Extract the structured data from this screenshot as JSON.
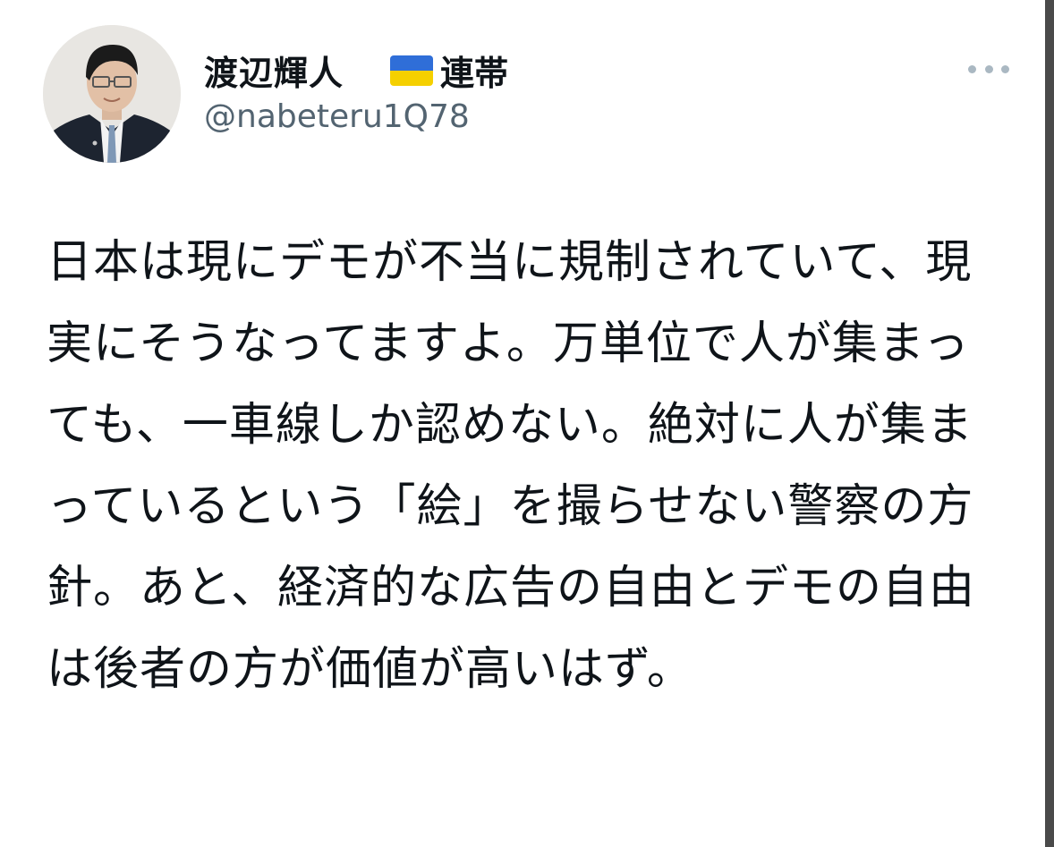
{
  "tweet": {
    "display_name": "渡辺輝人",
    "flag_icon": "ukraine-flag-icon",
    "name_suffix": "連帯",
    "handle": "@nabeteru1Q78",
    "text": "日本は現にデモが不当に規制されていて、現実にそうなってますよ。万単位で人が集まっても、一車線しか認めない。絶対に人が集まっているという「絵」を撮らせない警察の方針。あと、経済的な広告の自由とデモの自由は後者の方が価値が高いはず。",
    "more_icon": "more-options-icon",
    "avatar_icon": "profile-avatar"
  },
  "colors": {
    "text": "#0f1419",
    "handle": "#536471",
    "flag_blue": "#2f6ed8",
    "flag_yellow": "#f5d000",
    "more_dots": "#aab8c2"
  }
}
